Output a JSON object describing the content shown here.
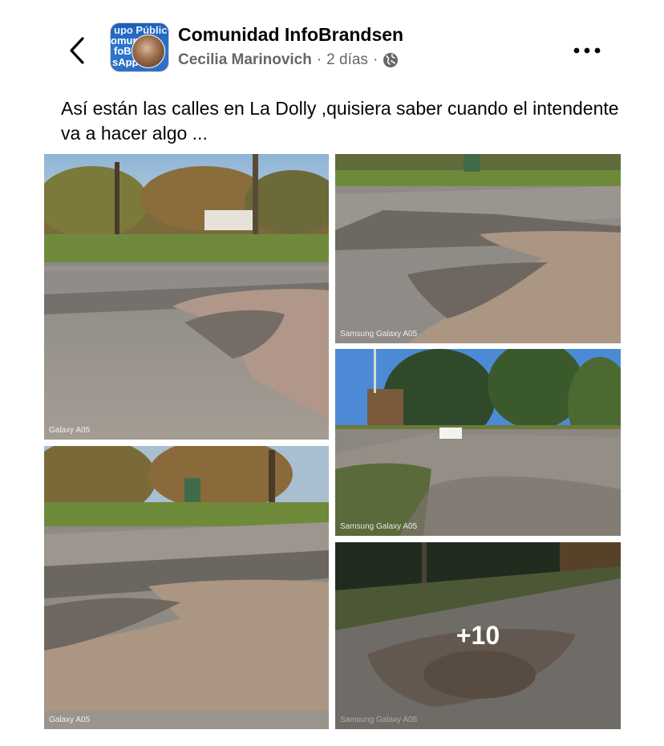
{
  "header": {
    "group_name": "Comunidad InfoBrandsen",
    "author": "Cecilia Marinovich",
    "separator": "·",
    "time": "2 días",
    "separator2": "·",
    "privacy_icon": "globe-icon",
    "back_icon": "chevron-left-icon",
    "more_icon": "more-dots-icon"
  },
  "avatar": {
    "line1": "upo Públic",
    "line2": "omunid",
    "line3": "foBr",
    "line4": "sApp"
  },
  "post": {
    "text": "Así están las calles en La Dolly ,quisiera saber cuando el intendente va  a hacer algo ..."
  },
  "photos": {
    "items": [
      {
        "caption": "Galaxy A05"
      },
      {
        "caption": "Samsung Galaxy A05"
      },
      {
        "caption": "Samsung Galaxy A05"
      },
      {
        "caption": "Galaxy A05"
      },
      {
        "caption": "Samsung Galaxy A05"
      }
    ],
    "more_count": "+10"
  },
  "colors": {
    "text_primary": "#050505",
    "text_secondary": "#65676b",
    "background": "#ffffff"
  }
}
